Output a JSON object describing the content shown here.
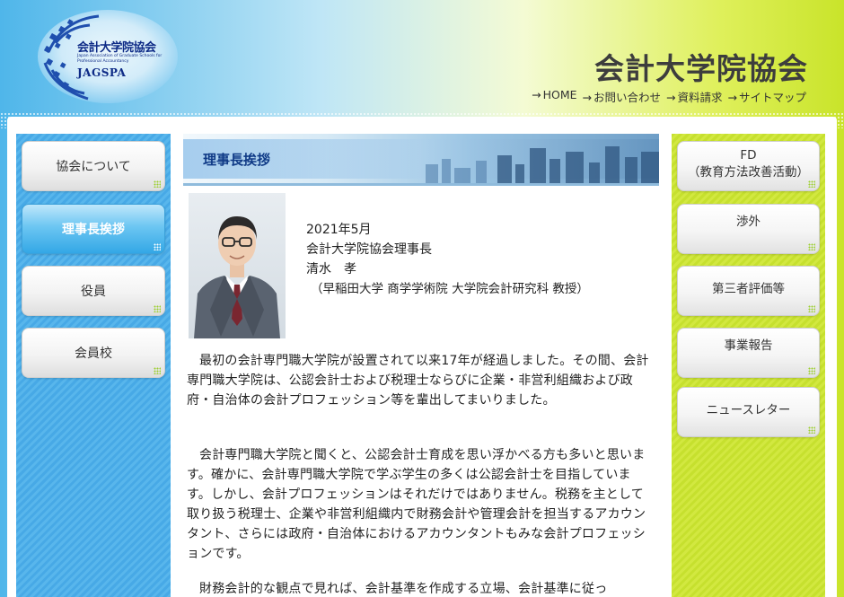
{
  "header": {
    "logo_title": "会計大学院協会",
    "logo_subtitle": "Japan Association of Graduate Schools for Professional Accountancy",
    "logo_abbr": "JAGSPA",
    "site_title": "会計大学院協会",
    "top_nav": [
      {
        "label": "HOME"
      },
      {
        "label": "お問い合わせ"
      },
      {
        "label": "資料請求"
      },
      {
        "label": "サイトマップ"
      }
    ]
  },
  "left_nav": [
    {
      "label": "協会について",
      "active": false
    },
    {
      "label": "理事長挨拶",
      "active": true
    },
    {
      "label": "役員",
      "active": false
    },
    {
      "label": "会員校",
      "active": false
    }
  ],
  "right_nav": [
    {
      "line1": "FD",
      "line2": "（教育方法改善活動）"
    },
    {
      "line1": "渉外"
    },
    {
      "line1": "第三者評価等"
    },
    {
      "line1": "事業報告"
    },
    {
      "line1": "ニュースレター"
    }
  ],
  "content": {
    "section_title": "理事長挨拶",
    "date": "2021年5月",
    "role": "会計大学院協会理事長",
    "name": "清水　孝",
    "affiliation": "（早稲田大学 商学学術院 大学院会計研究科 教授）",
    "paragraphs": [
      "最初の会計専門職大学院が設置されて以来17年が経過しました。その間、会計専門職大学院は、公認会計士および税理士ならびに企業・非営利組織および政府・自治体の会計プロフェッション等を輩出してまいりました。",
      "会計専門職大学院と聞くと、公認会計士育成を思い浮かべる方も多いと思います。確かに、会計専門職大学院で学ぶ学生の多くは公認会計士を目指しています。しかし、会計プロフェッションはそれだけではありません。税務を主として取り扱う税理士、企業や非営利組織内で財務会計や管理会計を担当するアカウンタント、さらには政府・自治体におけるアカウンタントもみな会計プロフェッションです。",
      "財務会計的な観点で見れば、会計基準を作成する立場、会計基準に従っ"
    ]
  },
  "colors": {
    "accent_blue": "#33a7e6",
    "accent_lime": "#c9e42a",
    "title_navy": "#0f3a86"
  }
}
